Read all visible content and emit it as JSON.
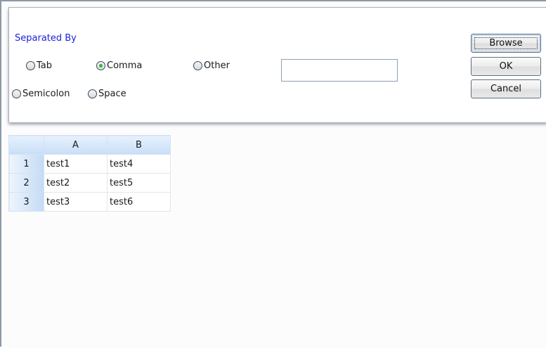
{
  "options": {
    "section_label": "Separated By",
    "radios": [
      {
        "label": "Tab",
        "checked": false
      },
      {
        "label": "Comma",
        "checked": true
      },
      {
        "label": "Other",
        "checked": false
      },
      {
        "label": "Semicolon",
        "checked": false
      },
      {
        "label": "Space",
        "checked": false
      }
    ],
    "other_value": ""
  },
  "buttons": {
    "browse": "Browse",
    "ok": "OK",
    "cancel": "Cancel"
  },
  "grid": {
    "columns": [
      "A",
      "B"
    ],
    "rows": [
      {
        "num": "1",
        "cells": [
          "test1",
          "test4"
        ]
      },
      {
        "num": "2",
        "cells": [
          "test2",
          "test5"
        ]
      },
      {
        "num": "3",
        "cells": [
          "test3",
          "test6"
        ]
      }
    ]
  },
  "colors": {
    "section_label": "#1c23d9",
    "radio_selected": "#36b13e",
    "header_blue": "#c9def7"
  }
}
